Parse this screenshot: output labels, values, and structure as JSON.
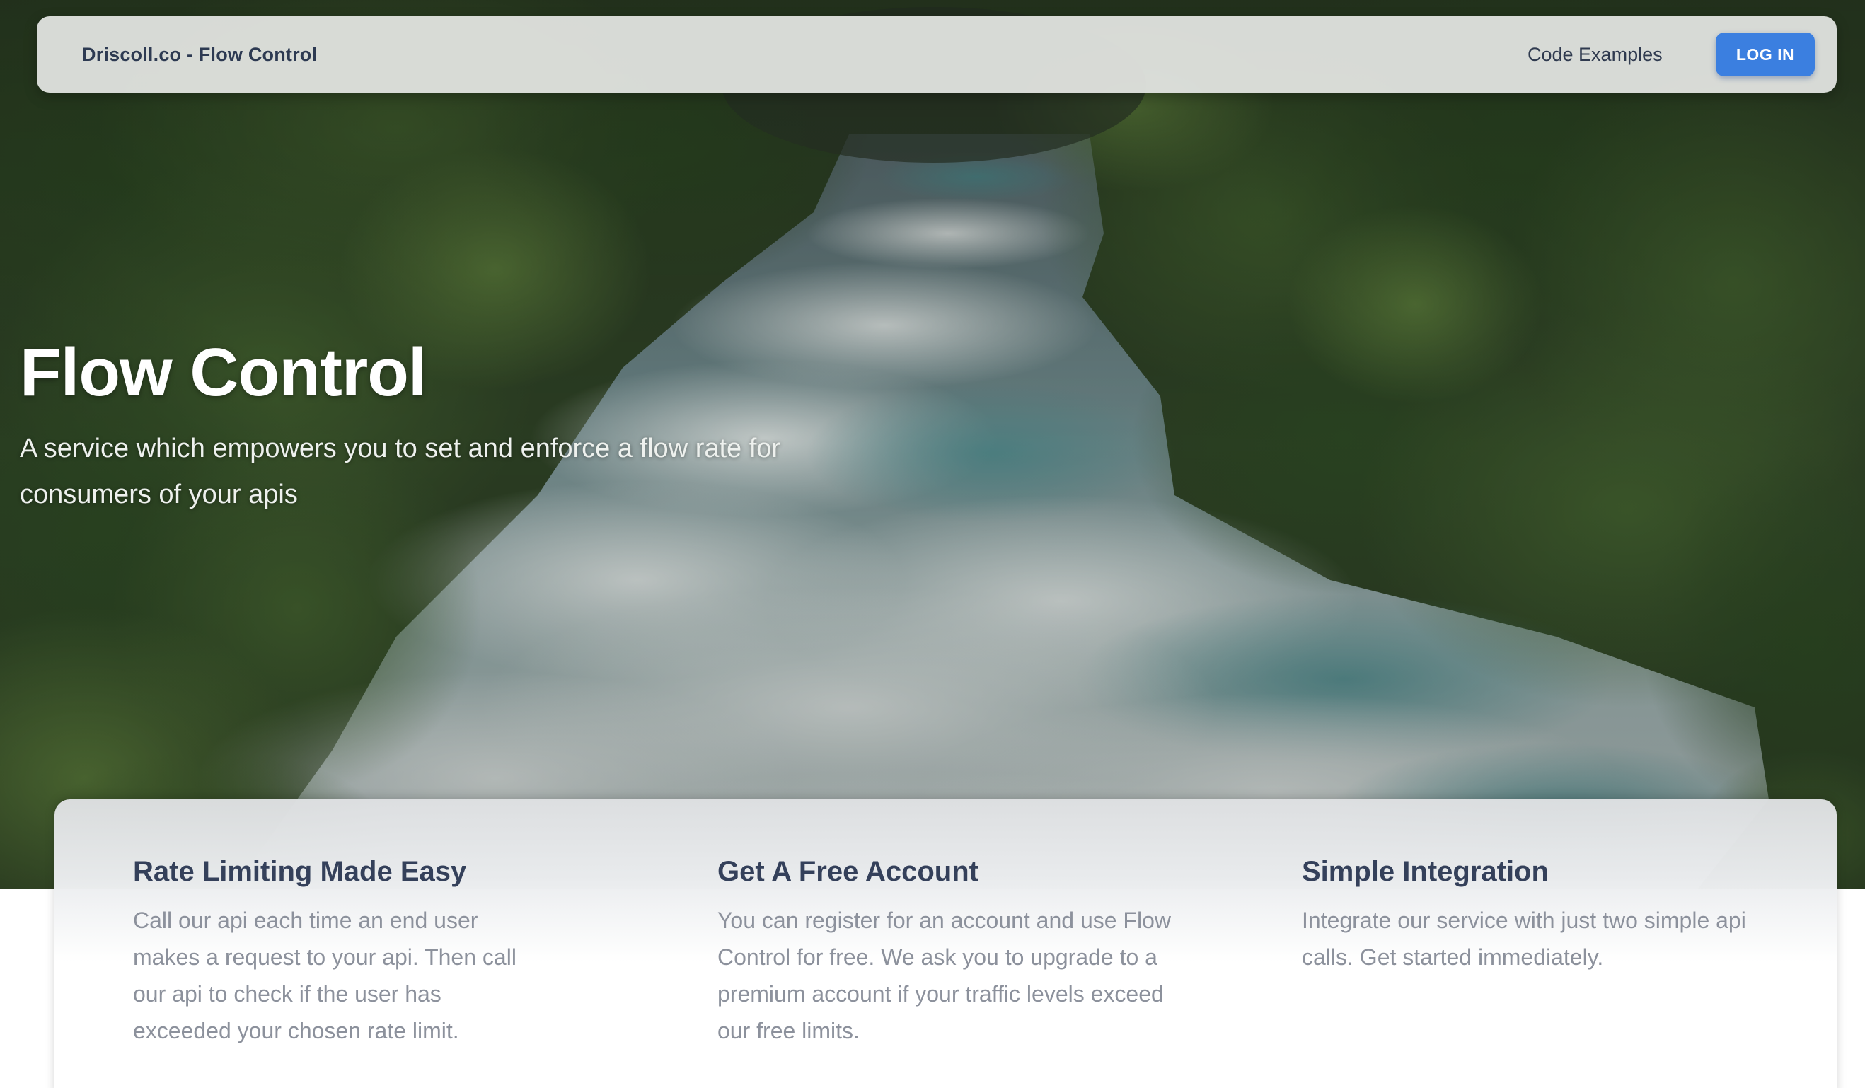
{
  "navbar": {
    "brand": "Driscoll.co - Flow Control",
    "links": [
      "Code Examples"
    ],
    "login_label": "LOG IN"
  },
  "hero": {
    "title": "Flow Control",
    "subtitle": "A service which empowers you to set and enforce a flow rate for consumers of your apis"
  },
  "features": [
    {
      "title": "Rate Limiting Made Easy",
      "text": "Call our api each time an end user makes a request to your api. Then call our api to check if the user has exceeded your chosen rate limit."
    },
    {
      "title": "Get A Free Account",
      "text": "You can register for an account and use Flow Control for free. We ask you to upgrade to a premium account if your traffic levels exceed our free limits."
    },
    {
      "title": "Simple Integration",
      "text": "Integrate our service with just two simple api calls. Get started immediately."
    }
  ],
  "colors": {
    "accent": "#3b7fe0",
    "heading": "#34405a",
    "body_text": "#8c919c"
  }
}
